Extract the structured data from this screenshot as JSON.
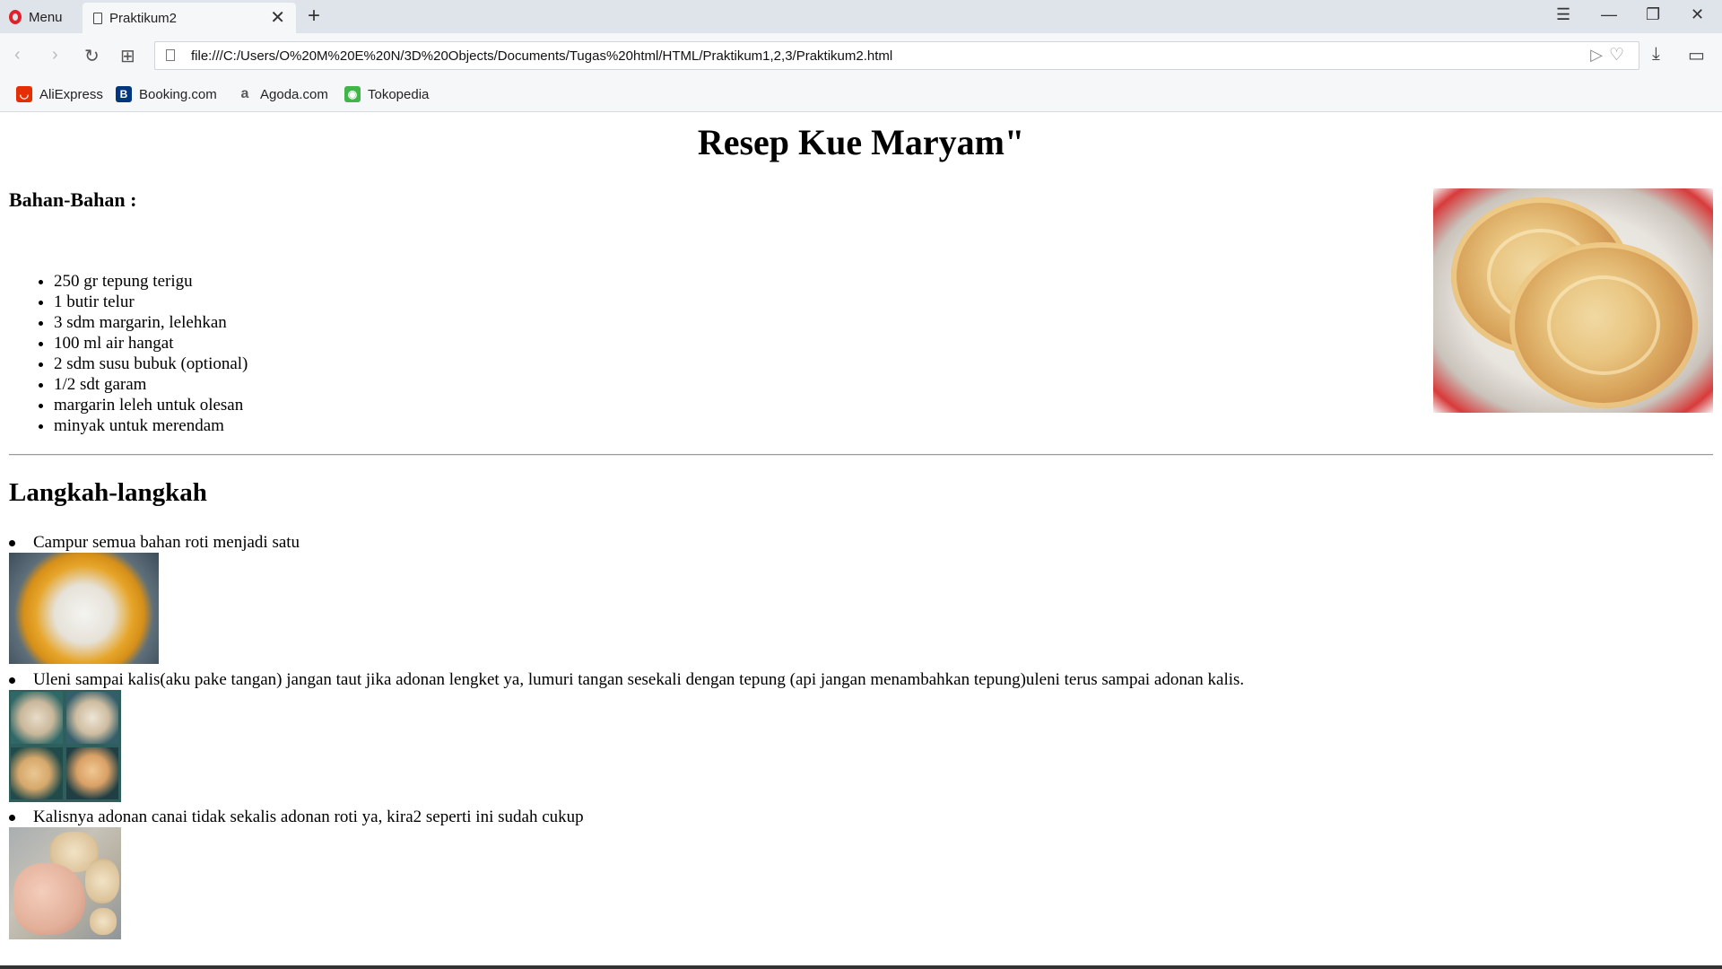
{
  "browser": {
    "menu_label": "Menu",
    "tab_title": "Praktikum2",
    "url": "file:///C:/Users/O%20M%20E%20N/3D%20Objects/Documents/Tugas%20html/HTML/Praktikum1,2,3/Praktikum2.html",
    "bookmarks": [
      {
        "label": "AliExpress",
        "icon": "aliexpress-icon",
        "color": "#e62e04"
      },
      {
        "label": "Booking.com",
        "icon": "booking-icon",
        "color": "#003580"
      },
      {
        "label": "Agoda.com",
        "icon": "agoda-icon",
        "color": "#5a5a5a"
      },
      {
        "label": "Tokopedia",
        "icon": "tokopedia-icon",
        "color": "#42b549"
      }
    ]
  },
  "page": {
    "title": "Resep Kue Maryam\"",
    "ingredients_title": "Bahan-Bahan :",
    "ingredients": [
      "250 gr tepung terigu",
      "1 butir telur",
      "3 sdm margarin, lelehkan",
      "100 ml air hangat",
      "2 sdm susu bubuk (optional)",
      "1/2 sdt garam",
      "margarin leleh untuk olesan",
      "minyak untuk merendam"
    ],
    "steps_title": "Langkah-langkah",
    "steps": [
      "Campur semua bahan roti menjadi satu",
      "Uleni sampai kalis(aku pake tangan) jangan taut jika adonan lengket ya, lumuri tangan sesekali dengan tepung (api jangan menambahkan tepung)uleni terus sampai adonan kalis.",
      "Kalisnya adonan canai tidak sekalis adonan roti ya, kira2 seperti ini sudah cukup"
    ]
  }
}
